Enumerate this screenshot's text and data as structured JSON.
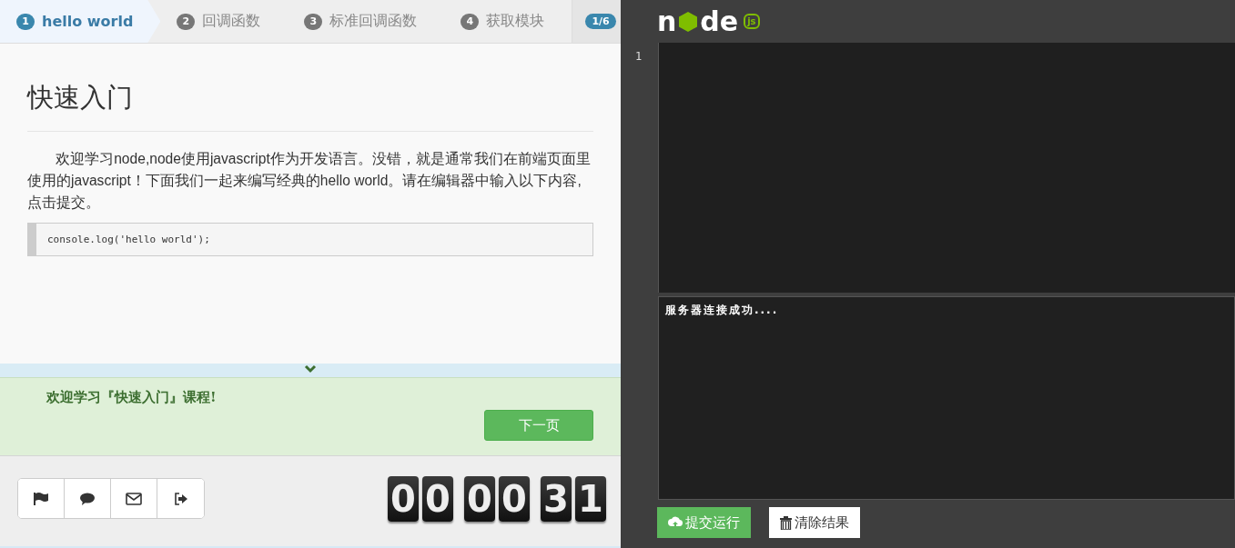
{
  "steps": [
    {
      "number": "1",
      "label": "hello world",
      "selected": true
    },
    {
      "number": "2",
      "label": "回调函数",
      "selected": false
    },
    {
      "number": "3",
      "label": "标准回调函数",
      "selected": false
    },
    {
      "number": "4",
      "label": "获取模块",
      "selected": false
    }
  ],
  "progress": "1/6",
  "lesson": {
    "title": "快速入门",
    "paragraph": "欢迎学习node,node使用javascript作为开发语言。没错，就是通常我们在前端页面里使用的javascript！下面我们一起来编写经典的hello world。请在编辑器中输入以下内容,点击提交。",
    "code": "console.log('hello world');"
  },
  "notice": {
    "message": "欢迎学习『快速入门』课程!",
    "next_button": "下一页"
  },
  "timer": {
    "digits": [
      "0",
      "0",
      "0",
      "0",
      "3",
      "1"
    ]
  },
  "logo": {
    "left": "n",
    "right": "de",
    "badge": "js"
  },
  "editor": {
    "line_numbers": [
      "1"
    ]
  },
  "output": {
    "text": "服务器连接成功...."
  },
  "actions": {
    "run": "提交运行",
    "clear": "清除结果"
  }
}
